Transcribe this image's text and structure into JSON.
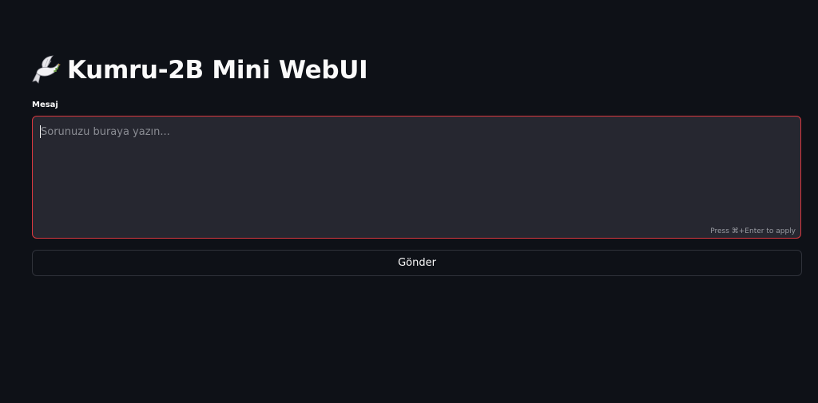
{
  "header": {
    "title": "Kumru-2B Mini WebUI",
    "icon": "dove-icon"
  },
  "form": {
    "message_label": "Mesaj",
    "message_placeholder": "Sorunuzu buraya yazın...",
    "message_value": "",
    "hint": "Press ⌘+Enter to apply",
    "submit_label": "Gönder"
  },
  "colors": {
    "background": "#0e1117",
    "input_background": "#262730",
    "focus_border": "#d9383f",
    "text": "#fafafa"
  }
}
